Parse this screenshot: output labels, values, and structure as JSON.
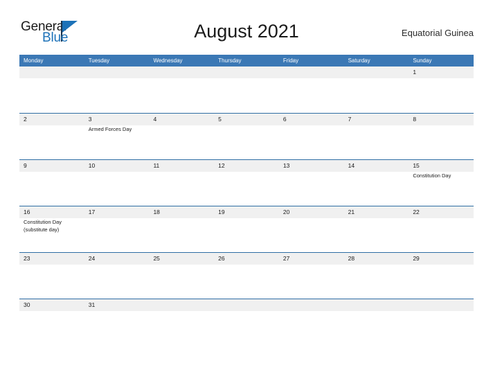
{
  "brand": {
    "name_part1": "General",
    "name_part2": "Blue",
    "triangle_icon": "triangle-icon",
    "accent_color": "#1d72b8"
  },
  "header": {
    "title": "August 2021",
    "region": "Equatorial Guinea"
  },
  "theme": {
    "header_blue": "#3b78b5",
    "row_rule_blue": "#2e6da4",
    "date_band_gray": "#f0f0f0",
    "text_dark": "#1a1a1a",
    "page_background": "#ffffff"
  },
  "calendar": {
    "month": "August",
    "year": "2021",
    "week_start": "Monday",
    "weekdays": [
      "Monday",
      "Tuesday",
      "Wednesday",
      "Thursday",
      "Friday",
      "Saturday",
      "Sunday"
    ],
    "weeks": [
      {
        "days": [
          {
            "num": "",
            "events": []
          },
          {
            "num": "",
            "events": []
          },
          {
            "num": "",
            "events": []
          },
          {
            "num": "",
            "events": []
          },
          {
            "num": "",
            "events": []
          },
          {
            "num": "",
            "events": []
          },
          {
            "num": "1",
            "events": []
          }
        ]
      },
      {
        "days": [
          {
            "num": "2",
            "events": []
          },
          {
            "num": "3",
            "events": [
              "Armed Forces Day"
            ]
          },
          {
            "num": "4",
            "events": []
          },
          {
            "num": "5",
            "events": []
          },
          {
            "num": "6",
            "events": []
          },
          {
            "num": "7",
            "events": []
          },
          {
            "num": "8",
            "events": []
          }
        ]
      },
      {
        "days": [
          {
            "num": "9",
            "events": []
          },
          {
            "num": "10",
            "events": []
          },
          {
            "num": "11",
            "events": []
          },
          {
            "num": "12",
            "events": []
          },
          {
            "num": "13",
            "events": []
          },
          {
            "num": "14",
            "events": []
          },
          {
            "num": "15",
            "events": [
              "Constitution Day"
            ]
          }
        ]
      },
      {
        "days": [
          {
            "num": "16",
            "events": [
              "Constitution Day",
              "(substitute day)"
            ]
          },
          {
            "num": "17",
            "events": []
          },
          {
            "num": "18",
            "events": []
          },
          {
            "num": "19",
            "events": []
          },
          {
            "num": "20",
            "events": []
          },
          {
            "num": "21",
            "events": []
          },
          {
            "num": "22",
            "events": []
          }
        ]
      },
      {
        "days": [
          {
            "num": "23",
            "events": []
          },
          {
            "num": "24",
            "events": []
          },
          {
            "num": "25",
            "events": []
          },
          {
            "num": "26",
            "events": []
          },
          {
            "num": "27",
            "events": []
          },
          {
            "num": "28",
            "events": []
          },
          {
            "num": "29",
            "events": []
          }
        ]
      },
      {
        "days": [
          {
            "num": "30",
            "events": []
          },
          {
            "num": "31",
            "events": []
          },
          {
            "num": "",
            "events": []
          },
          {
            "num": "",
            "events": []
          },
          {
            "num": "",
            "events": []
          },
          {
            "num": "",
            "events": []
          },
          {
            "num": "",
            "events": []
          }
        ]
      }
    ]
  }
}
